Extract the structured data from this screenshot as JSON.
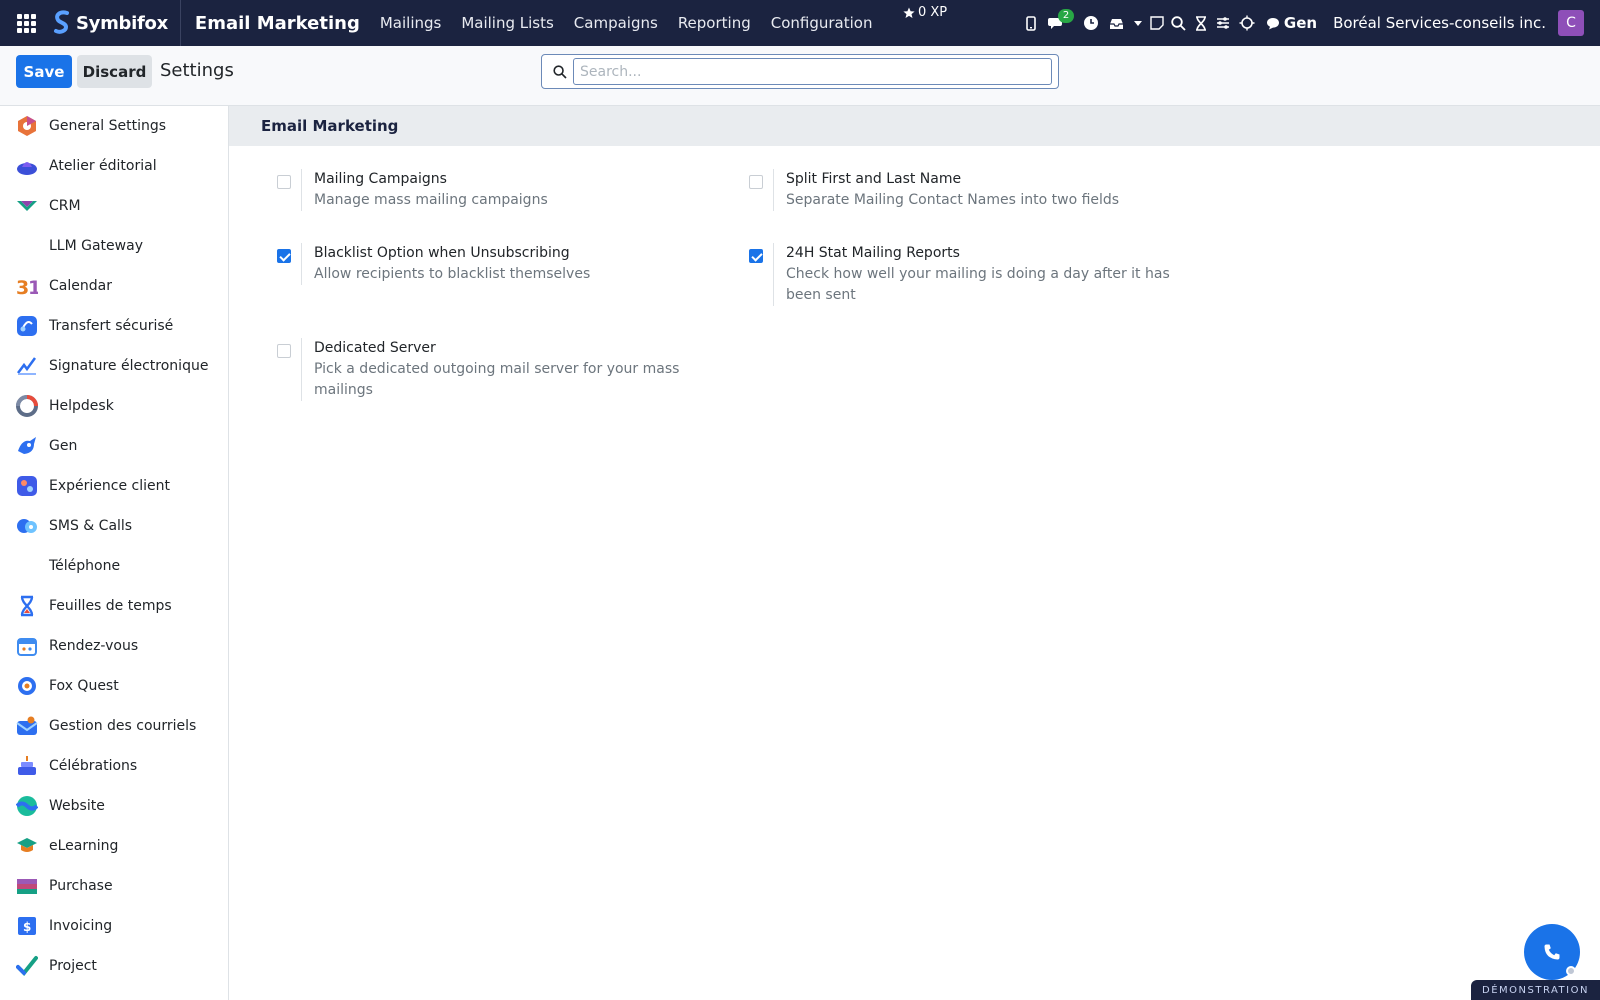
{
  "navbar": {
    "brand": "Symbifox",
    "app_title": "Email Marketing",
    "menu": [
      "Mailings",
      "Mailing Lists",
      "Campaigns",
      "Reporting",
      "Configuration"
    ],
    "xp": "0 XP",
    "messages_badge": "2",
    "gen_label": "Gen",
    "company": "Boréal Services-conseils inc.",
    "avatar_initial": "C"
  },
  "control": {
    "save_label": "Save",
    "discard_label": "Discard",
    "title": "Settings",
    "search_placeholder": "Search..."
  },
  "sidebar": {
    "items": [
      {
        "label": "General Settings",
        "icon": "general-settings-icon"
      },
      {
        "label": "Atelier éditorial",
        "icon": "atelier-icon"
      },
      {
        "label": "CRM",
        "icon": "crm-icon"
      },
      {
        "label": "LLM Gateway",
        "icon": ""
      },
      {
        "label": "Calendar",
        "icon": "calendar-icon"
      },
      {
        "label": "Transfert sécurisé",
        "icon": "transfer-icon"
      },
      {
        "label": "Signature électronique",
        "icon": "signature-icon"
      },
      {
        "label": "Helpdesk",
        "icon": "helpdesk-icon"
      },
      {
        "label": "Gen",
        "icon": "gen-icon"
      },
      {
        "label": "Expérience client",
        "icon": "experience-icon"
      },
      {
        "label": "SMS & Calls",
        "icon": "sms-icon"
      },
      {
        "label": "Téléphone",
        "icon": ""
      },
      {
        "label": "Feuilles de temps",
        "icon": "timesheet-icon"
      },
      {
        "label": "Rendez-vous",
        "icon": "appointment-icon"
      },
      {
        "label": "Fox Quest",
        "icon": "fox-quest-icon"
      },
      {
        "label": "Gestion des courriels",
        "icon": "email-management-icon"
      },
      {
        "label": "Célébrations",
        "icon": "celebration-icon"
      },
      {
        "label": "Website",
        "icon": "website-icon"
      },
      {
        "label": "eLearning",
        "icon": "elearning-icon"
      },
      {
        "label": "Purchase",
        "icon": "purchase-icon"
      },
      {
        "label": "Invoicing",
        "icon": "invoicing-icon"
      },
      {
        "label": "Project",
        "icon": "project-icon"
      }
    ]
  },
  "main": {
    "section_title": "Email Marketing",
    "settings": [
      {
        "title": "Mailing Campaigns",
        "description": "Manage mass mailing campaigns",
        "checked": false
      },
      {
        "title": "Split First and Last Name",
        "description": "Separate Mailing Contact Names into two fields",
        "checked": false
      },
      {
        "title": "Blacklist Option when Unsubscribing",
        "description": "Allow recipients to blacklist themselves",
        "checked": true
      },
      {
        "title": "24H Stat Mailing Reports",
        "description": "Check how well your mailing is doing a day after it has been sent",
        "checked": true
      },
      {
        "title": "Dedicated Server",
        "description": "Pick a dedicated outgoing mail server for your mass mailings",
        "checked": false
      }
    ]
  },
  "footer": {
    "demo_ribbon": "DÉMONSTRATION"
  },
  "colors": {
    "navbar_bg": "#1b2340",
    "primary": "#1a73e8",
    "badge": "#28a745",
    "avatar": "#8e4fb8"
  }
}
